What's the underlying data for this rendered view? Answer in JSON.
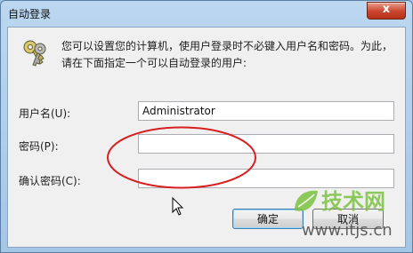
{
  "window": {
    "title": "自动登录",
    "close_glyph": "x"
  },
  "description": "您可以设置您的计算机，使用户登录时不必键入用户名和密码。为此，请在下面指定一个可以自动登录的用户:",
  "form": {
    "username_label": "用户名(U):",
    "username_value": "Administrator",
    "password_label": "密码(P):",
    "password_value": "",
    "confirm_label": "确认密码(C):",
    "confirm_value": ""
  },
  "buttons": {
    "ok": "确定",
    "cancel": "取消"
  },
  "watermark": {
    "brand": "技术网",
    "url": "www.itjs.cn",
    "accent_green": "#7cc242",
    "text_color": "#4a4a4a"
  },
  "annotation": {
    "ellipse_color": "#d81e1e"
  },
  "icons": {
    "dialog_icon": "keys-icon",
    "cursor": "mouse-pointer-icon"
  }
}
